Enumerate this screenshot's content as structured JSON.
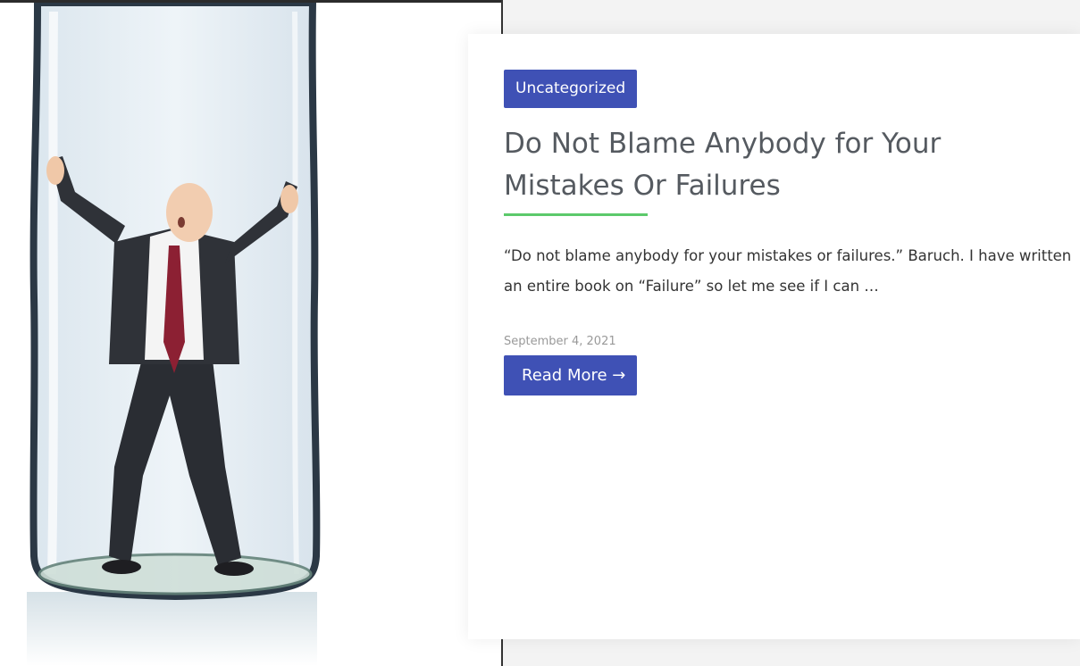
{
  "post": {
    "category": "Uncategorized",
    "title": "Do Not Blame Anybody for Your Mistakes Or Failures",
    "excerpt": "“Do not blame anybody for your mistakes or failures.” Baruch. I have written an entire book on “Failure” so let me see if I can …",
    "date": "September 4, 2021",
    "read_more": "Read More →"
  },
  "image": {
    "subject": "man-trapped-in-glass-bottle"
  },
  "colors": {
    "accent": "#3f51b5",
    "title_underline": "#5cc96b",
    "title_text": "#555a60",
    "body_text": "#333333",
    "date_text": "#999999",
    "page_background": "#f3f3f3"
  }
}
